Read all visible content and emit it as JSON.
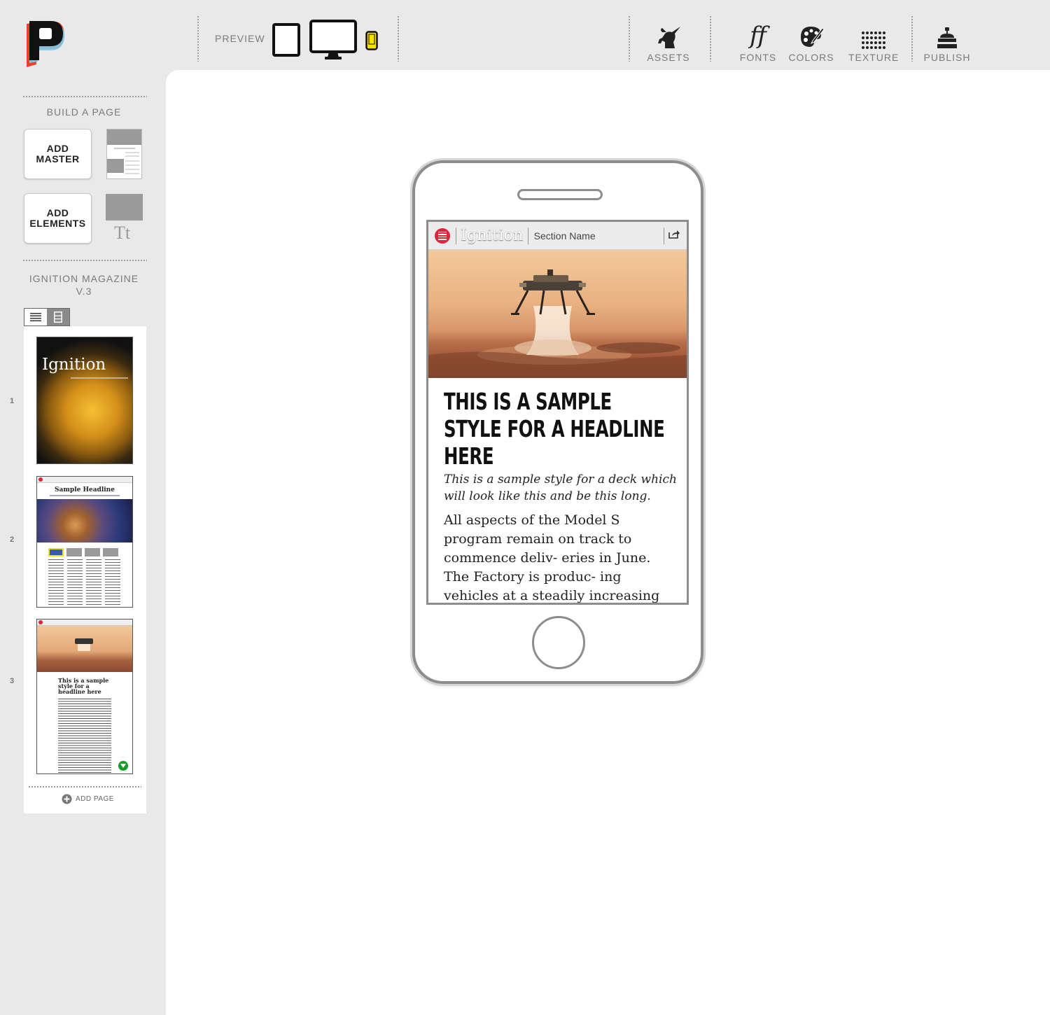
{
  "toolbar": {
    "preview_label": "PREVIEW",
    "devices": [
      {
        "name": "tablet",
        "label": "tablet-icon"
      },
      {
        "name": "desktop",
        "label": "desktop-icon"
      },
      {
        "name": "phone",
        "label": "phone-icon"
      }
    ],
    "tools": [
      {
        "label": "ASSETS",
        "icon": "unicorn-icon"
      },
      {
        "label": "FONTS",
        "icon": "fonts-icon"
      },
      {
        "label": "COLORS",
        "icon": "palette-icon"
      },
      {
        "label": "TEXTURE",
        "icon": "texture-icon"
      },
      {
        "label": "PUBLISH",
        "icon": "publish-icon"
      }
    ],
    "fonts_glyph": "ff",
    "accent_phone": "#f5e000"
  },
  "sidebar": {
    "build_title": "BUILD A PAGE",
    "add_master_label": "ADD MASTER",
    "add_elements_label": "ADD ELEMENTS",
    "text_sample": "Tt",
    "magazine_title": "IGNITION MAGAZINE V.3",
    "pages": [
      {
        "number": "1",
        "title": "Ignition"
      },
      {
        "number": "2",
        "title": "Sample Headline"
      },
      {
        "number": "3",
        "title": "This is a sample style for a headline here"
      }
    ],
    "add_page_label": "ADD PAGE"
  },
  "preview": {
    "brand": "Ignition",
    "section_name": "Section Name",
    "headline": "THIS IS A SAMPLE STYLE FOR A HEADLINE HERE",
    "deck": "This is a sample style for a deck which will look like this and be this long.",
    "body": "All aspects of the Model S program remain on track to commence deliv- eries in June. The Factory is produc- ing vehicles at a steadily increasing rate, and so are dedicated to a com- prehensive testing program, includ- ing crash and safety testing, systems",
    "menu_color": "#e0243a"
  }
}
